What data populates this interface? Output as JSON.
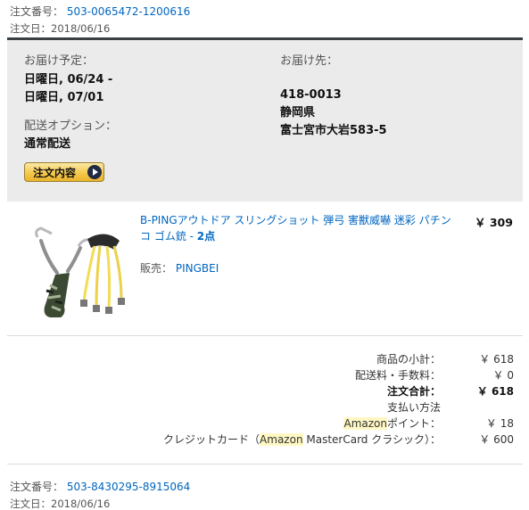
{
  "order1": {
    "number_label": "注文番号：",
    "number": "503-0065472-1200616",
    "date": "注文日：2018/06/16"
  },
  "shipping": {
    "eta_label": "お届け予定：",
    "eta_line1": "日曜日, 06/24 -",
    "eta_line2": "日曜日, 07/01",
    "option_label": "配送オプション：",
    "option_value": "通常配送",
    "details_button": "注文内容",
    "dest_label": "お届け先：",
    "postal": "418-0013",
    "prefecture": "静岡県",
    "city": "富士宮市大岩583-5"
  },
  "item": {
    "title": "B-PINGアウトドア スリングショット 弾弓 害獣威嚇 迷彩 パチンコ ゴム銃 - ",
    "qty": "2点",
    "price": "￥ 309",
    "seller_label": "販売：",
    "seller": "PINGBEI",
    "image_icon": "slingshot-product-image"
  },
  "totals": {
    "subtotal_label": "商品の小計：",
    "subtotal": "￥ 618",
    "shipping_label": "配送料・手数料：",
    "shipping": "￥ 0",
    "total_label": "注文合計：",
    "total": "￥ 618",
    "payment_label": "支払い方法",
    "points_pre": "Amazon",
    "points_post": "ポイント：",
    "points": "￥ 18",
    "card_pre": "クレジットカード（",
    "card_hl": "Amazon",
    "card_post": " MasterCard クラシック）：",
    "card": "￥ 600"
  },
  "order2": {
    "number_label": "注文番号：",
    "number": "503-8430295-8915064",
    "date": "注文日：2018/06/16"
  }
}
